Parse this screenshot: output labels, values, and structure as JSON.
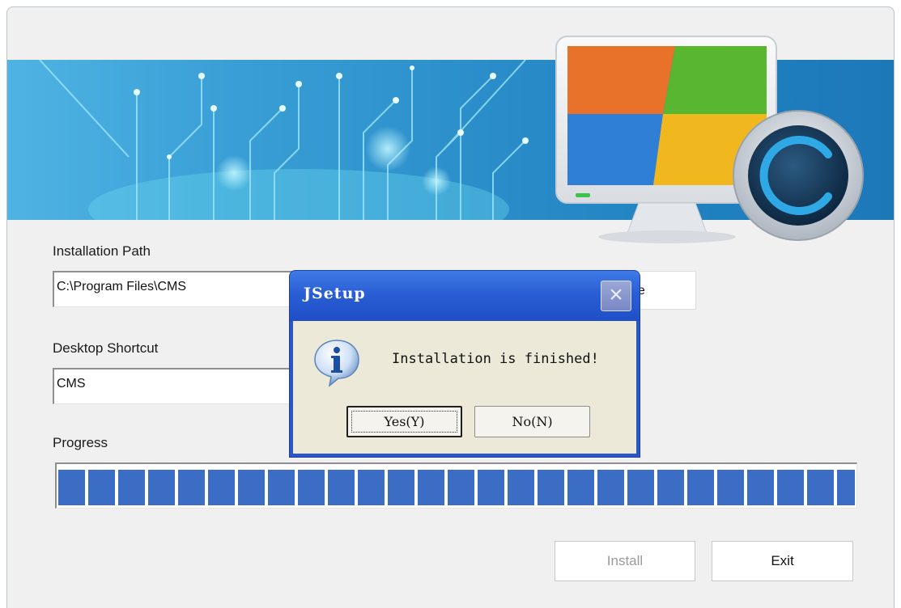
{
  "installer": {
    "installation_path_label": "Installation Path",
    "installation_path_value": "C:\\Program Files\\CMS",
    "change_button_label": "ge",
    "desktop_shortcut_label": "Desktop Shortcut",
    "desktop_shortcut_value": "CMS",
    "progress_label": "Progress",
    "progress_value": 1.0,
    "install_button_label": "Install",
    "exit_button_label": "Exit"
  },
  "dialog": {
    "title": "JSetup",
    "close_glyph": "×",
    "icon": "info-icon",
    "message": "Installation is finished!",
    "yes_label": "Yes(Y)",
    "no_label": "No(N)"
  },
  "colors": {
    "banner": "#2a8dc9",
    "progress": "#3b6dc4",
    "dialog_titlebar": "#2a5ed5",
    "dialog_body": "#ece9d8"
  }
}
